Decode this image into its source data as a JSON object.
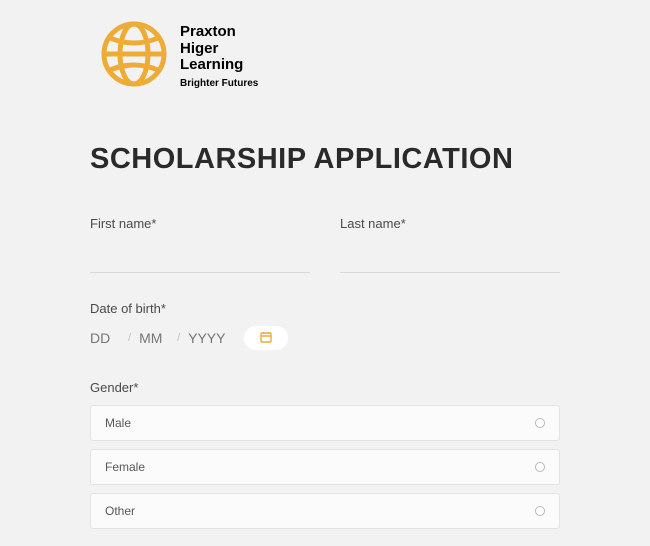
{
  "brand": {
    "line1": "Praxton",
    "line2": "Higer",
    "line3": "Learning",
    "tagline": "Brighter Futures"
  },
  "title": "SCHOLARSHIP APPLICATION",
  "fields": {
    "first_name_label": "First name*",
    "last_name_label": "Last name*",
    "first_name_value": "",
    "last_name_value": ""
  },
  "dob": {
    "label": "Date of birth*",
    "dd_placeholder": "DD",
    "mm_placeholder": "MM",
    "yyyy_placeholder": "YYYY",
    "separator": "/"
  },
  "gender": {
    "label": "Gender*",
    "options": [
      {
        "label": "Male"
      },
      {
        "label": "Female"
      },
      {
        "label": "Other"
      }
    ]
  },
  "colors": {
    "accent": "#eeac36"
  }
}
